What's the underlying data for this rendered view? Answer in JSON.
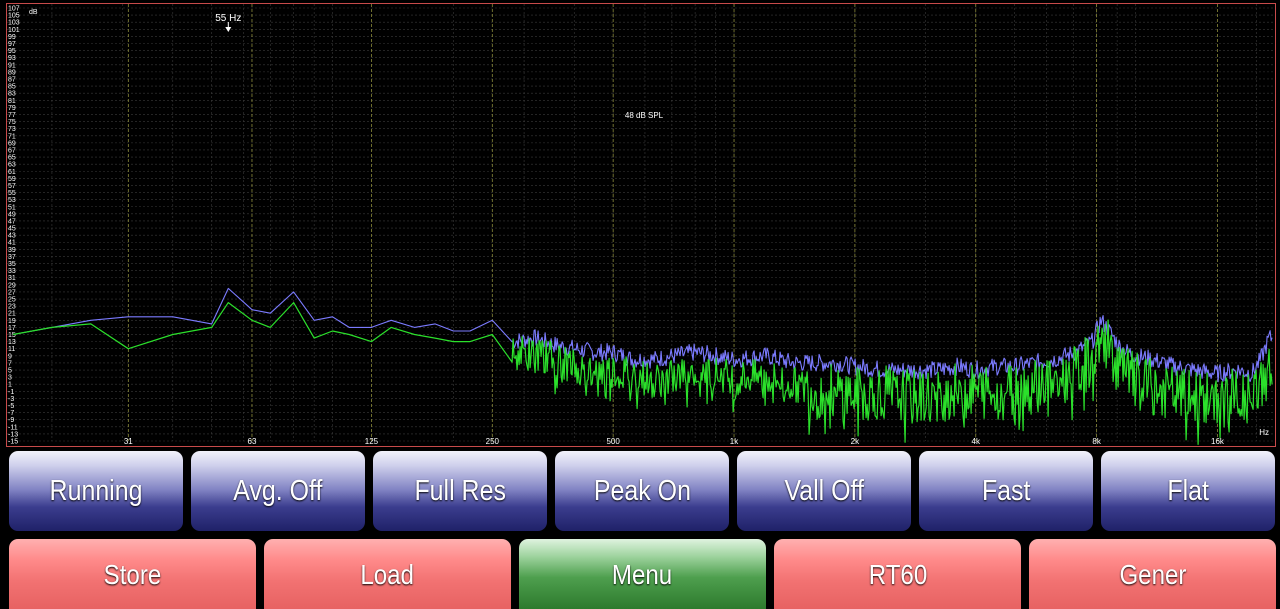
{
  "colors": {
    "grid_major": "#8a8a3a",
    "grid_minor": "#3a3a3a",
    "frame": "#c84b4b",
    "text": "#ffffff",
    "trace_peak": "#7b7bff",
    "trace_live": "#2be02b"
  },
  "plot": {
    "db_unit": "dB",
    "hz_unit": "Hz",
    "marker_label": "55 Hz",
    "spl_label": "48 dB SPL"
  },
  "chart_data": {
    "type": "line",
    "title": "",
    "x_scale": "log",
    "x_tick_labels": [
      "31",
      "63",
      "125",
      "250",
      "500",
      "1k",
      "2k",
      "4k",
      "8k",
      "16k"
    ],
    "x_ticks": [
      31,
      63,
      125,
      250,
      500,
      1000,
      2000,
      4000,
      8000,
      16000
    ],
    "xlim": [
      16,
      22000
    ],
    "ylim": [
      -15,
      107
    ],
    "y_tick_labels": [
      "107",
      "105",
      "103",
      "101",
      "99",
      "97",
      "95",
      "93",
      "91",
      "89",
      "87",
      "85",
      "83",
      "81",
      "79",
      "77",
      "75",
      "73",
      "71",
      "69",
      "67",
      "65",
      "63",
      "61",
      "59",
      "57",
      "55",
      "53",
      "51",
      "49",
      "47",
      "45",
      "43",
      "41",
      "39",
      "37",
      "35",
      "33",
      "31",
      "29",
      "27",
      "25",
      "23",
      "21",
      "19",
      "17",
      "15",
      "13",
      "11",
      "9",
      "7",
      "5",
      "3",
      "1",
      "-1",
      "-3",
      "-5",
      "-7",
      "-9",
      "-11",
      "-13",
      "-15"
    ],
    "marker_hz": 55,
    "series": [
      {
        "x": [
          16,
          20,
          25,
          31,
          40,
          50,
          55,
          63,
          70,
          80,
          90,
          100,
          110,
          125,
          140,
          160,
          180,
          200,
          220,
          250,
          280,
          320,
          360,
          400,
          450,
          500,
          560,
          630,
          710,
          800,
          900,
          1000,
          1200,
          1400,
          1600,
          1800,
          2000,
          2400,
          2800,
          3200,
          3600,
          4000,
          4500,
          5000,
          5600,
          6300,
          7100,
          7800,
          8200,
          8600,
          9200,
          10000,
          11000,
          12500,
          14000,
          16000,
          18000,
          19500,
          20500,
          21500
        ],
        "y": [
          15,
          17,
          19,
          20,
          20,
          18,
          28,
          22,
          21,
          27,
          19,
          20,
          17,
          17,
          19,
          17,
          18,
          16,
          16,
          19,
          13,
          14,
          12,
          11,
          10,
          10,
          8,
          8,
          9,
          10,
          9,
          8,
          9,
          7,
          7,
          7,
          6,
          5,
          5,
          5,
          6,
          5,
          6,
          6,
          7,
          8,
          10,
          13,
          19,
          16,
          11,
          9,
          8,
          6,
          5,
          4,
          5,
          4,
          8,
          14
        ]
      },
      {
        "x": [
          16,
          20,
          25,
          31,
          40,
          50,
          55,
          63,
          70,
          80,
          90,
          100,
          110,
          125,
          140,
          160,
          180,
          200,
          220,
          250,
          280,
          320,
          360,
          400,
          450,
          500,
          560,
          630,
          710,
          800,
          900,
          1000,
          1200,
          1400,
          1600,
          1800,
          2000,
          2400,
          2800,
          3200,
          3600,
          4000,
          4500,
          5000,
          5600,
          6300,
          7100,
          7800,
          8200,
          8600,
          9200,
          10000,
          11000,
          12500,
          14000,
          16000,
          18000,
          19500,
          20500,
          21500
        ],
        "y": [
          15,
          17,
          18,
          11,
          15,
          17,
          24,
          19,
          17,
          24,
          14,
          16,
          15,
          13,
          17,
          15,
          14,
          13,
          13,
          15,
          10,
          10,
          8,
          6,
          5,
          5,
          4,
          2,
          3,
          5,
          4,
          3,
          3,
          1,
          -1,
          -1,
          -2,
          -1,
          -3,
          -2,
          -1,
          -1,
          -1,
          0,
          1,
          2,
          4,
          8,
          15,
          11,
          5,
          2,
          0,
          -2,
          -3,
          -3,
          -2,
          -4,
          1,
          5
        ]
      }
    ]
  },
  "buttons_top": [
    {
      "label": "Running"
    },
    {
      "label": "Avg. Off"
    },
    {
      "label": "Full Res"
    },
    {
      "label": "Peak On"
    },
    {
      "label": "Vall Off"
    },
    {
      "label": "Fast"
    },
    {
      "label": "Flat"
    }
  ],
  "buttons_bottom": [
    {
      "label": "Store",
      "color": "red"
    },
    {
      "label": "Load",
      "color": "red"
    },
    {
      "label": "Menu",
      "color": "green"
    },
    {
      "label": "RT60",
      "color": "red"
    },
    {
      "label": "Gener",
      "color": "red"
    }
  ]
}
